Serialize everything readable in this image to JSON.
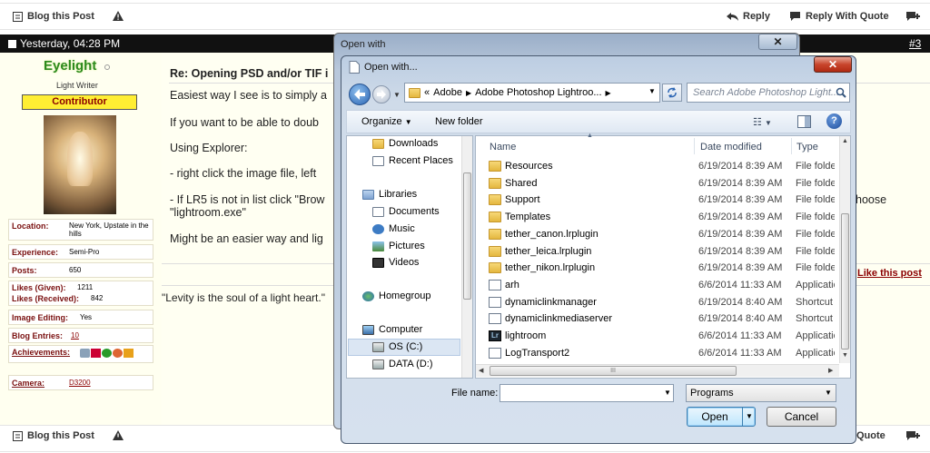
{
  "forum": {
    "top_bar": {
      "blog_label": "Blog this Post",
      "reply_label": "Reply",
      "reply_quote_label": "Reply With Quote"
    },
    "bottom_bar": {
      "blog_label": "Blog this Post",
      "reply_quote_label": "Quote"
    },
    "post_header": {
      "timestamp": "Yesterday, 04:28 PM",
      "post_number": "#3"
    },
    "user": {
      "name": "Eyelight",
      "title": "Light Writer",
      "rank_badge": "Contributor",
      "location_label": "Location:",
      "location_value": "New York, Upstate in the hills",
      "experience_label": "Experience:",
      "experience_value": "Semi-Pro",
      "posts_label": "Posts:",
      "posts_value": "650",
      "likes_given_label": "Likes (Given):",
      "likes_given_value": "1211",
      "likes_received_label": "Likes (Received):",
      "likes_received_value": "842",
      "image_editing_label": "Image Editing:",
      "image_editing_value": "Yes",
      "blog_entries_label": "Blog Entries:",
      "blog_entries_value": "10",
      "achievements_label": "Achievements:",
      "camera_label": "Camera:",
      "camera_value": "D3200"
    },
    "post": {
      "title": "Re: Opening PSD and/or TIF i",
      "line1": "Easiest way I see is to simply a",
      "line2": "If you want to be able to doub",
      "line3": "Using Explorer:",
      "line4": "- right click the image file, left",
      "line5": "- If LR5 is not in list click \"Brow",
      "line5_tail": "hoose",
      "line6": "\"lightroom.exe\"",
      "line7": "Might be an easier way and lig",
      "like_link": "Like this post",
      "signature": "\"Levity is the soul of a light heart.\""
    }
  },
  "open_with_bg": {
    "title": "Open with"
  },
  "dialog": {
    "title": "Open with...",
    "address": {
      "prefix": "«",
      "crumb1": "Adobe",
      "crumb2": "Adobe Photoshop Lightroo..."
    },
    "search_placeholder": "Search Adobe Photoshop Light...",
    "toolbar": {
      "organize": "Organize",
      "new_folder": "New folder"
    },
    "nav": {
      "downloads": "Downloads",
      "recent_places": "Recent Places",
      "libraries": "Libraries",
      "documents": "Documents",
      "music": "Music",
      "pictures": "Pictures",
      "videos": "Videos",
      "homegroup": "Homegroup",
      "computer": "Computer",
      "os_c": "OS (C:)",
      "data_d": "DATA (D:)"
    },
    "columns": {
      "name": "Name",
      "date": "Date modified",
      "type": "Type"
    },
    "files": [
      {
        "name": "Resources",
        "date": "6/19/2014 8:39 AM",
        "type": "File folder",
        "icon": "folder-icon"
      },
      {
        "name": "Shared",
        "date": "6/19/2014 8:39 AM",
        "type": "File folder",
        "icon": "folder-icon"
      },
      {
        "name": "Support",
        "date": "6/19/2014 8:39 AM",
        "type": "File folder",
        "icon": "folder-icon"
      },
      {
        "name": "Templates",
        "date": "6/19/2014 8:39 AM",
        "type": "File folder",
        "icon": "folder-icon"
      },
      {
        "name": "tether_canon.lrplugin",
        "date": "6/19/2014 8:39 AM",
        "type": "File folder",
        "icon": "folder-icon"
      },
      {
        "name": "tether_leica.lrplugin",
        "date": "6/19/2014 8:39 AM",
        "type": "File folder",
        "icon": "folder-icon"
      },
      {
        "name": "tether_nikon.lrplugin",
        "date": "6/19/2014 8:39 AM",
        "type": "File folder",
        "icon": "folder-icon"
      },
      {
        "name": "arh",
        "date": "6/6/2014 11:33 AM",
        "type": "Application",
        "icon": "app-icon"
      },
      {
        "name": "dynamiclinkmanager",
        "date": "6/19/2014 8:40 AM",
        "type": "Shortcut",
        "icon": "shortcut-icon"
      },
      {
        "name": "dynamiclinkmediaserver",
        "date": "6/19/2014 8:40 AM",
        "type": "Shortcut",
        "icon": "shortcut-icon"
      },
      {
        "name": "lightroom",
        "date": "6/6/2014 11:33 AM",
        "type": "Application",
        "icon": "lightroom-icon"
      },
      {
        "name": "LogTransport2",
        "date": "6/6/2014 11:33 AM",
        "type": "Application",
        "icon": "app-icon"
      }
    ],
    "scroll_mark": "III",
    "file_name_label": "File name:",
    "file_name_value": "",
    "file_type": "Programs",
    "open_button": "Open",
    "cancel_button": "Cancel"
  },
  "colors": {
    "accent_green": "#2d8a1e",
    "badge_yellow": "#ffee33",
    "link_red": "#8b0000"
  }
}
